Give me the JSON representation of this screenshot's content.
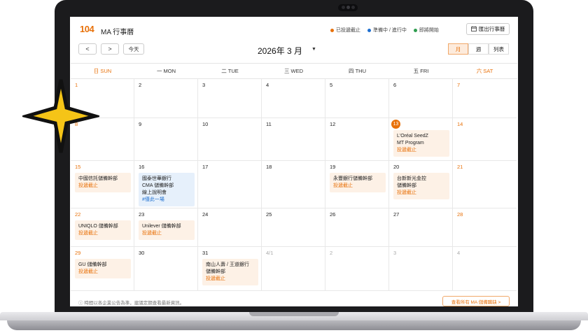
{
  "colors": {
    "accent": "#e8710a",
    "blue": "#1e6fd0",
    "green": "#2e9d4f"
  },
  "app": {
    "logo": "104",
    "title": "MA 行事曆",
    "export_label": "匯出行事曆"
  },
  "legend": [
    {
      "label": "已投遞截止",
      "color": "#e8710a"
    },
    {
      "label": "準備中 / 進行中",
      "color": "#1e6fd0"
    },
    {
      "label": "即將開始",
      "color": "#2e9d4f"
    }
  ],
  "nav": {
    "prev": "<",
    "next": ">",
    "today": "今天",
    "month": "2026年 3 月",
    "views": [
      "月",
      "週",
      "列表"
    ]
  },
  "weekdays": [
    "日 SUN",
    "一 MON",
    "二 TUE",
    "三 WED",
    "四 THU",
    "五 FRI",
    "六 SAT"
  ],
  "weeks": [
    [
      {
        "day": "1"
      },
      {
        "day": "2"
      },
      {
        "day": "3"
      },
      {
        "day": "4"
      },
      {
        "day": "5"
      },
      {
        "day": "6"
      },
      {
        "day": "7"
      }
    ],
    [
      {
        "day": "8"
      },
      {
        "day": "9"
      },
      {
        "day": "10"
      },
      {
        "day": "11"
      },
      {
        "day": "12"
      },
      {
        "day": "13",
        "today": true,
        "event": {
          "lines": [
            "L'Oréal SeedZ",
            "MT Program"
          ],
          "status": "投遞截止"
        }
      },
      {
        "day": "14"
      }
    ],
    [
      {
        "day": "15",
        "event": {
          "lines": [
            "中國信託儲備幹部"
          ],
          "status": "投遞截止"
        }
      },
      {
        "day": "16",
        "event": {
          "lines": [
            "國泰世華銀行",
            "CMA 儲備幹部",
            "線上說明會"
          ],
          "tag": "#僅此一場",
          "blue": true
        }
      },
      {
        "day": "17"
      },
      {
        "day": "18"
      },
      {
        "day": "19",
        "event": {
          "lines": [
            "永豐銀行儲備幹部"
          ],
          "status": "投遞截止"
        }
      },
      {
        "day": "20",
        "event": {
          "lines": [
            "台新新光金控",
            "儲備幹部"
          ],
          "status": "投遞截止"
        }
      },
      {
        "day": "21"
      }
    ],
    [
      {
        "day": "22",
        "event": {
          "lines": [
            "UNIQLO 儲備幹部"
          ],
          "status": "投遞截止"
        }
      },
      {
        "day": "23",
        "event": {
          "lines": [
            "Unilever 儲備幹部"
          ],
          "status": "投遞截止"
        }
      },
      {
        "day": "24"
      },
      {
        "day": "25"
      },
      {
        "day": "26"
      },
      {
        "day": "27"
      },
      {
        "day": "28"
      }
    ],
    [
      {
        "day": "29",
        "event": {
          "lines": [
            "GU 儲備幹部"
          ],
          "status": "投遞截止"
        }
      },
      {
        "day": "30"
      },
      {
        "day": "31",
        "event": {
          "lines": [
            "南山人壽 / 王道銀行",
            "儲備幹部"
          ],
          "status": "投遞截止"
        }
      },
      {
        "day": "4/1",
        "other": true
      },
      {
        "day": "2",
        "other": true
      },
      {
        "day": "3",
        "other": true
      },
      {
        "day": "4",
        "other": true
      }
    ]
  ],
  "footer": {
    "note": "ⓘ 時間以各企業公告為準，建議定期查看最新資訊。",
    "all_label": "查看所有 MA 儲備職缺 >"
  }
}
